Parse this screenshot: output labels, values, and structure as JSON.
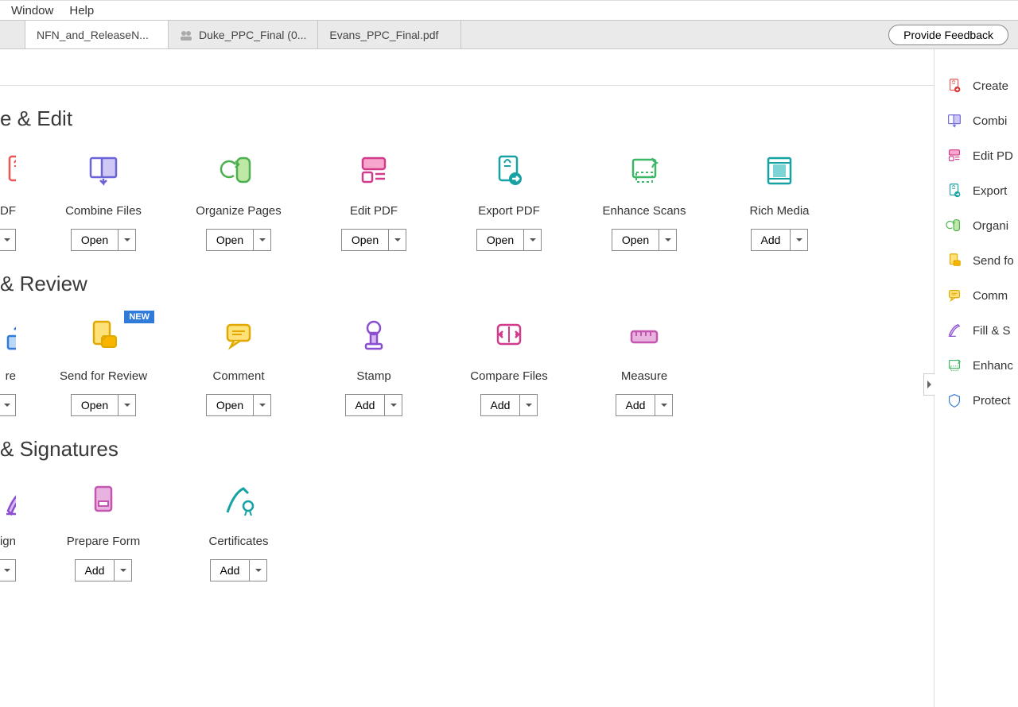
{
  "menu": {
    "window": "Window",
    "help": "Help"
  },
  "tabs": {
    "t1": "NFN_and_ReleaseN...",
    "t2": "Duke_PPC_Final (0...",
    "t3": "Evans_PPC_Final.pdf"
  },
  "feedback": "Provide Feedback",
  "buttons": {
    "open": "Open",
    "add": "Add"
  },
  "badges": {
    "new": "NEW"
  },
  "sections": {
    "s1": {
      "title": "e & Edit",
      "cards": [
        {
          "label": "e PDF",
          "btn": "open_caret_only",
          "icon": "create-pdf",
          "cut": true
        },
        {
          "label": "Combine Files",
          "btn": "open",
          "icon": "combine-files"
        },
        {
          "label": "Organize Pages",
          "btn": "open",
          "icon": "organize-pages"
        },
        {
          "label": "Edit PDF",
          "btn": "open",
          "icon": "edit-pdf"
        },
        {
          "label": "Export PDF",
          "btn": "open",
          "icon": "export-pdf"
        },
        {
          "label": "Enhance Scans",
          "btn": "open",
          "icon": "enhance-scans"
        },
        {
          "label": "Rich Media",
          "btn": "add",
          "icon": "rich-media"
        }
      ]
    },
    "s2": {
      "title": "& Review",
      "cards": [
        {
          "label": "re",
          "btn": "open_caret_only",
          "icon": "share",
          "cut": true
        },
        {
          "label": "Send for Review",
          "btn": "open",
          "icon": "send-review",
          "new": true
        },
        {
          "label": "Comment",
          "btn": "open",
          "icon": "comment"
        },
        {
          "label": "Stamp",
          "btn": "add",
          "icon": "stamp"
        },
        {
          "label": "Compare Files",
          "btn": "add",
          "icon": "compare"
        },
        {
          "label": "Measure",
          "btn": "add",
          "icon": "measure"
        }
      ]
    },
    "s3": {
      "title": "& Signatures",
      "cards": [
        {
          "label": "Sign",
          "btn": "open_caret_only",
          "icon": "fill-sign",
          "cut": true
        },
        {
          "label": "Prepare Form",
          "btn": "add",
          "icon": "prepare-form"
        },
        {
          "label": "Certificates",
          "btn": "add",
          "icon": "certificates"
        }
      ]
    }
  },
  "rpanel": [
    {
      "label": "Create",
      "icon": "create-pdf"
    },
    {
      "label": "Combi",
      "icon": "combine-files"
    },
    {
      "label": "Edit PD",
      "icon": "edit-pdf"
    },
    {
      "label": "Export ",
      "icon": "export-pdf"
    },
    {
      "label": "Organi",
      "icon": "organize-pages"
    },
    {
      "label": "Send fo",
      "icon": "send-review"
    },
    {
      "label": "Comm",
      "icon": "comment"
    },
    {
      "label": "Fill & S",
      "icon": "fill-sign"
    },
    {
      "label": "Enhanc",
      "icon": "enhance-scans"
    },
    {
      "label": "Protect",
      "icon": "protect"
    }
  ]
}
